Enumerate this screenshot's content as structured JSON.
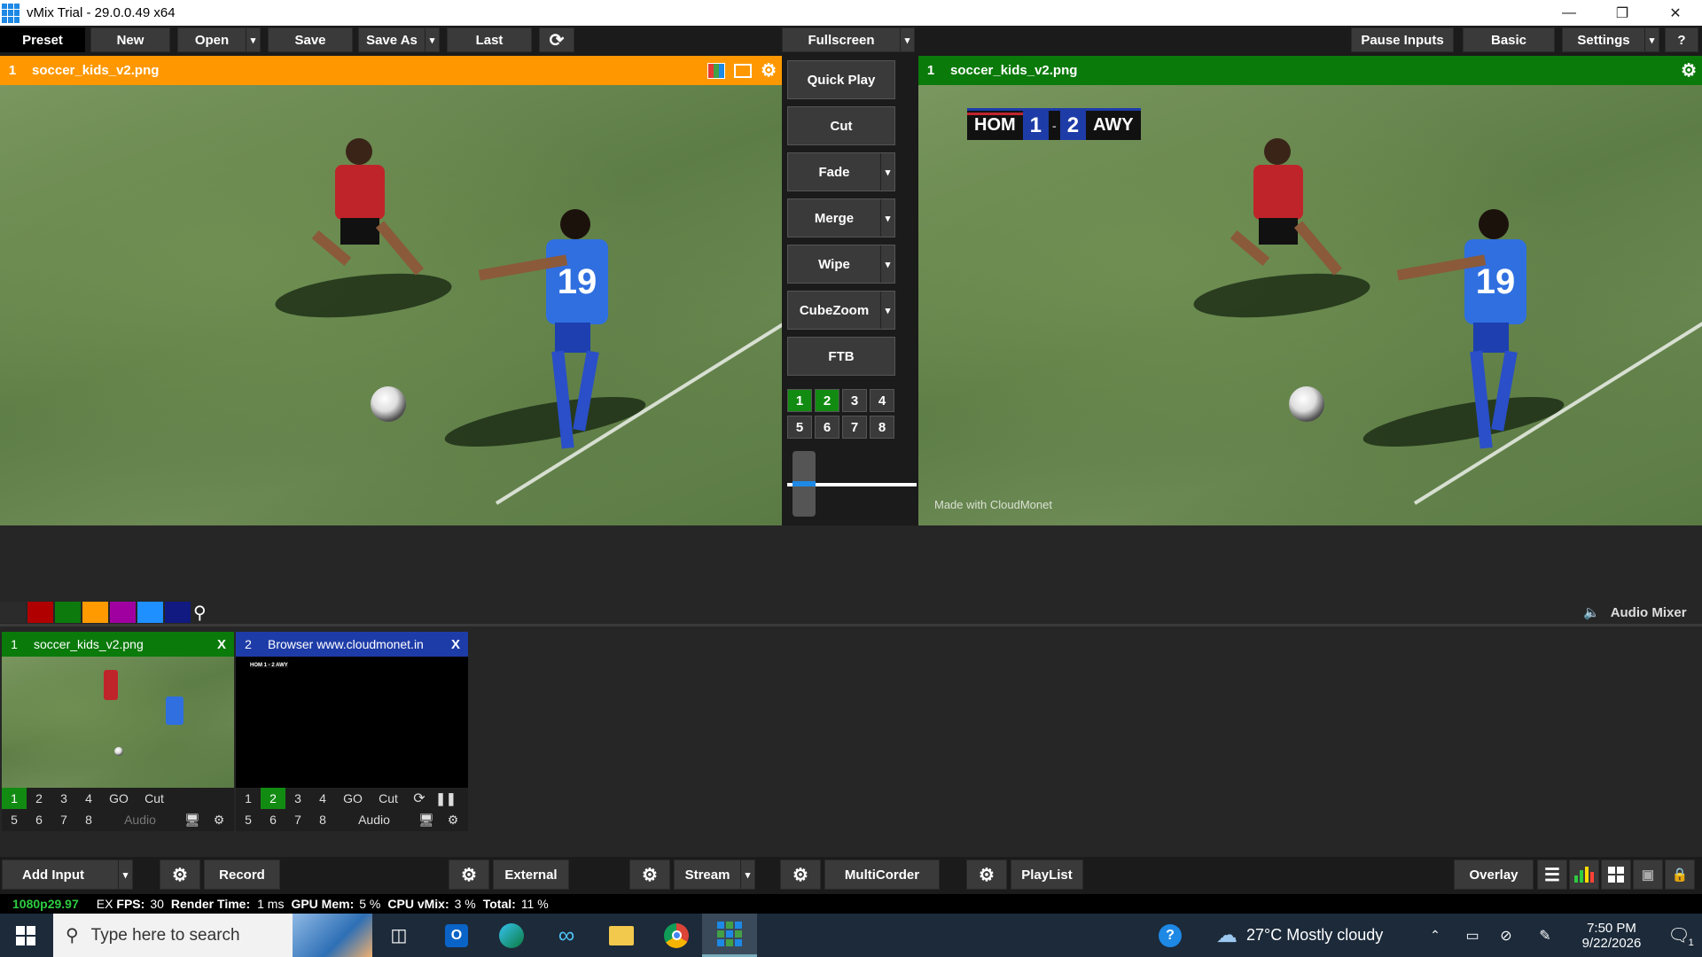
{
  "window": {
    "title": "vMix Trial - 29.0.0.49 x64"
  },
  "toolbar": {
    "preset": "Preset",
    "new": "New",
    "open": "Open",
    "save": "Save",
    "save_as": "Save As",
    "last": "Last",
    "fullscreen": "Fullscreen",
    "pause_inputs": "Pause Inputs",
    "basic": "Basic",
    "settings": "Settings",
    "help": "?"
  },
  "preview": {
    "number": "1",
    "title": "soccer_kids_v2.png"
  },
  "output": {
    "number": "1",
    "title": "soccer_kids_v2.png",
    "watermark": "Made with CloudMonet"
  },
  "scoreboard": {
    "home": "HOM",
    "home_score": "1",
    "sep": "-",
    "away_score": "2",
    "away": "AWY"
  },
  "transitions": {
    "quick_play": "Quick Play",
    "cut": "Cut",
    "fade": "Fade",
    "merge": "Merge",
    "wipe": "Wipe",
    "cubezoom": "CubeZoom",
    "ftb": "FTB",
    "quick_numbers": [
      "1",
      "2",
      "3",
      "4",
      "5",
      "6",
      "7",
      "8"
    ],
    "slider_position": 0.05
  },
  "color_tags": [
    "#2b2b2b",
    "#b00000",
    "#0d7a0d",
    "#ff9a00",
    "#a000a0",
    "#1e90ff",
    "#101a80"
  ],
  "audio_mixer": "Audio Mixer",
  "inputs": [
    {
      "number": "1",
      "title": "soccer_kids_v2.png",
      "close": "X",
      "row1": [
        "1",
        "2",
        "3",
        "4",
        "GO",
        "Cut"
      ],
      "row2": [
        "5",
        "6",
        "7",
        "8",
        "Audio"
      ],
      "active": "1"
    },
    {
      "number": "2",
      "title": "Browser www.cloudmonet.in",
      "close": "X",
      "row1": [
        "1",
        "2",
        "3",
        "4",
        "GO",
        "Cut"
      ],
      "row2": [
        "5",
        "6",
        "7",
        "8",
        "Audio"
      ],
      "active": "2",
      "thumb_score": "HOM 1 - 2 AWY"
    }
  ],
  "bottombar": {
    "add_input": "Add Input",
    "record": "Record",
    "external": "External",
    "stream": "Stream",
    "multicorder": "MultiCorder",
    "playlist": "PlayList",
    "overlay": "Overlay"
  },
  "status": {
    "format": "1080p29.97",
    "ex": "EX",
    "fps_label": "FPS:",
    "fps": "30",
    "render_label": "Render Time:",
    "render": "1 ms",
    "gpu_label": "GPU Mem:",
    "gpu": "5 %",
    "cpu_label": "CPU vMix:",
    "cpu": "3 %",
    "total_label": "Total:",
    "total": "11 %"
  },
  "taskbar": {
    "search_placeholder": "Type here to search",
    "weather": "27°C  Mostly cloudy",
    "time": "7:50 PM",
    "date": "9/22/2026",
    "notifications": "1"
  },
  "colors": {
    "preview_bar": "#ff9800",
    "output_bar": "#0a7a0a",
    "active_green": "#128b12"
  }
}
